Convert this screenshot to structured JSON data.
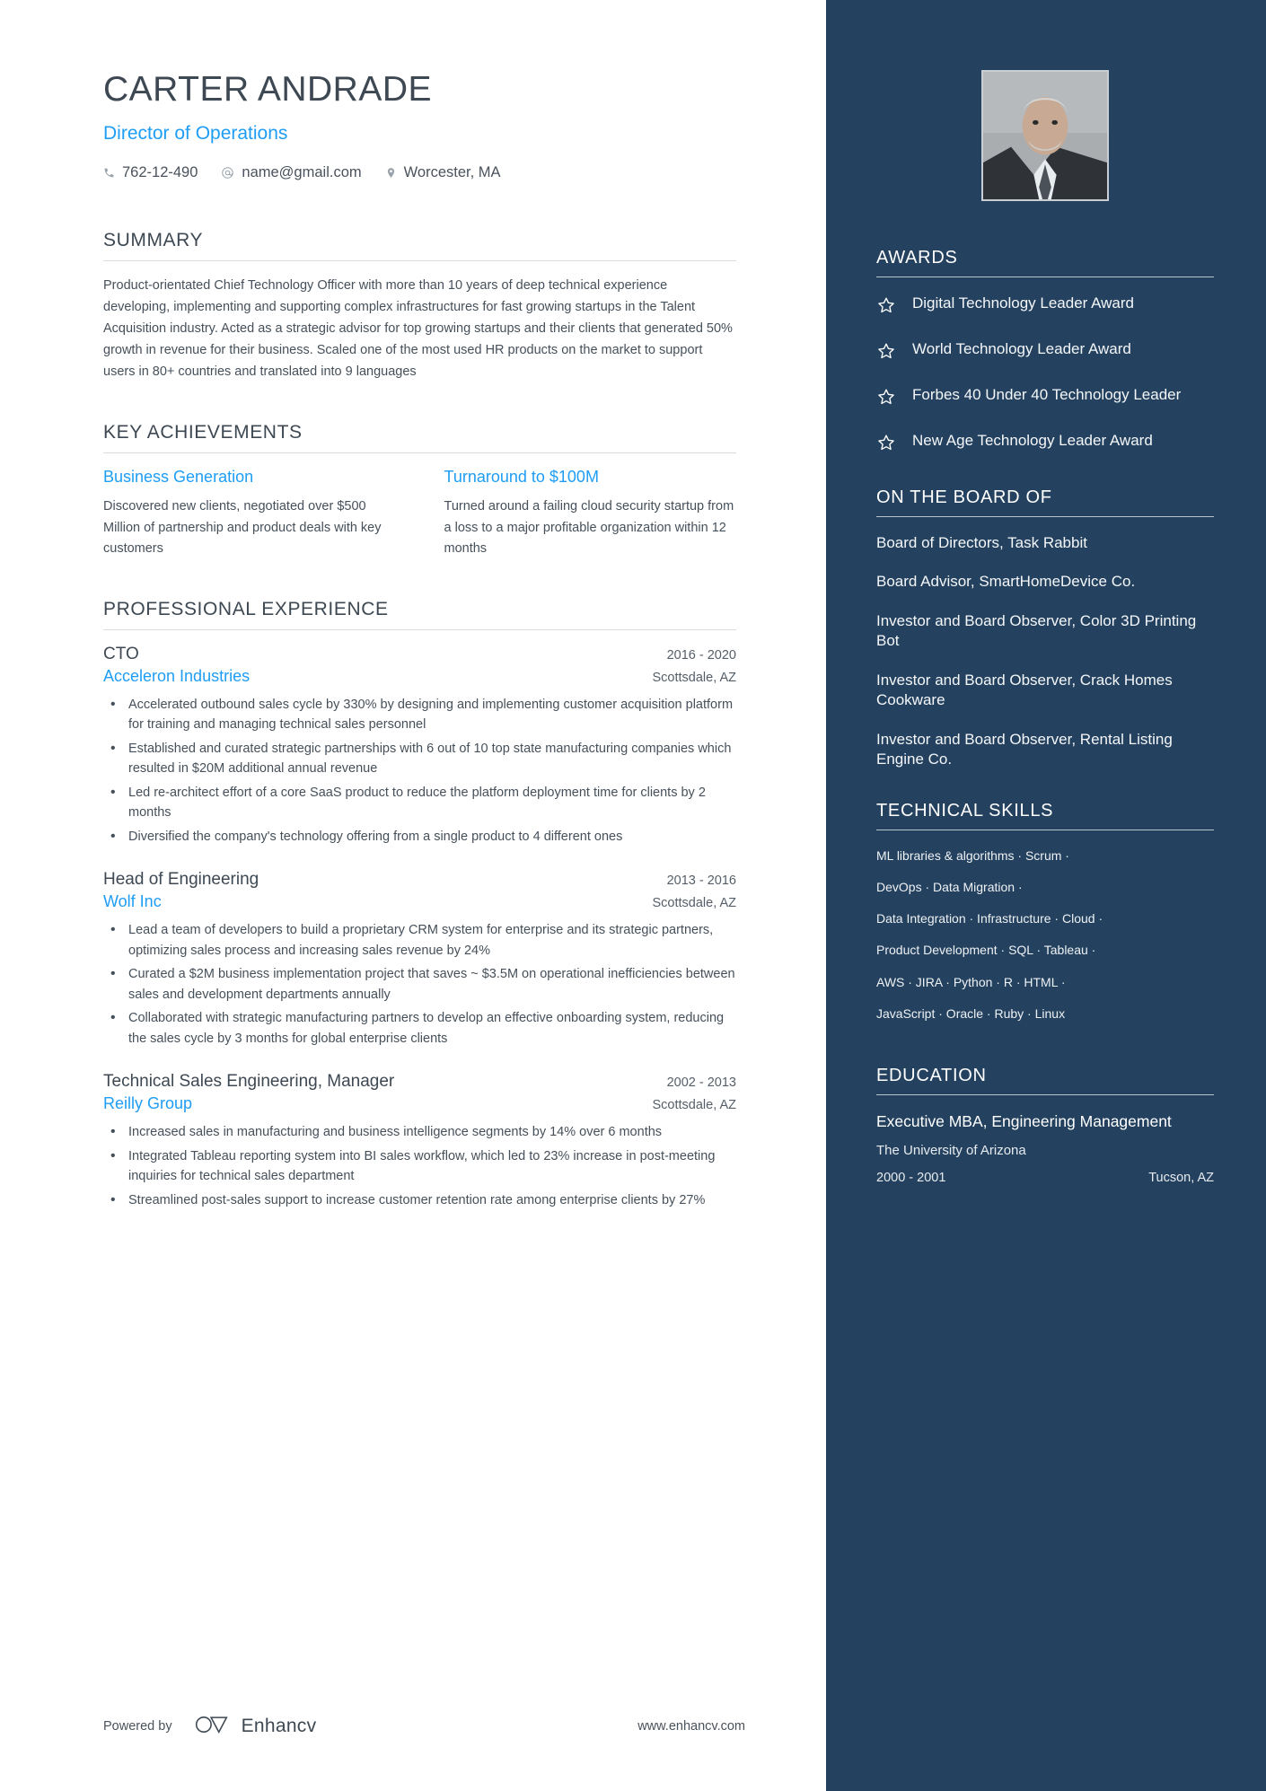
{
  "header": {
    "name": "CARTER ANDRADE",
    "job_title": "Director of Operations",
    "contacts": [
      {
        "icon": "phone-icon",
        "value": "762-12-490"
      },
      {
        "icon": "at-icon",
        "value": "name@gmail.com"
      },
      {
        "icon": "location-pin-icon",
        "value": "Worcester, MA"
      }
    ]
  },
  "summary": {
    "heading": "SUMMARY",
    "text": "Product-orientated Chief Technology Officer with more than 10 years of deep technical experience developing, implementing and supporting complex infrastructures for fast growing startups in the Talent Acquisition industry. Acted as a strategic advisor for top growing startups and their clients that generated 50% growth in revenue for their business. Scaled one of the most used HR products on the market to support users in 80+ countries and translated into 9 languages"
  },
  "key_achievements": {
    "heading": "KEY ACHIEVEMENTS",
    "items": [
      {
        "title": "Business Generation",
        "description": "Discovered new clients, negotiated over $500 Million of partnership and product deals with key customers"
      },
      {
        "title": "Turnaround to $100M",
        "description": "Turned around a failing cloud security startup from a loss to a major profitable organization within 12 months"
      }
    ]
  },
  "experience": {
    "heading": "PROFESSIONAL EXPERIENCE",
    "jobs": [
      {
        "role": "CTO",
        "date": "2016 - 2020",
        "company": "Acceleron Industries",
        "location": "Scottsdale, AZ",
        "bullets": [
          "Accelerated outbound sales cycle by 330% by designing and implementing customer acquisition platform for training and managing technical sales personnel",
          "Established and curated strategic partnerships with 6 out of 10 top state manufacturing companies which resulted in $20M additional annual revenue",
          "Led re-architect effort of a core SaaS product to reduce the platform deployment time for clients by 2 months",
          "Diversified the company's technology offering from a single product to 4 different ones"
        ]
      },
      {
        "role": "Head of Engineering",
        "date": "2013 - 2016",
        "company": "Wolf Inc",
        "location": "Scottsdale, AZ",
        "bullets": [
          "Lead a team of developers to build a proprietary CRM system for enterprise and its strategic partners, optimizing sales process and increasing sales revenue by 24%",
          "Curated a $2M business implementation project that saves ~ $3.5M on operational inefficiencies between sales and development departments annually",
          "Collaborated with strategic manufacturing partners to develop an effective onboarding system, reducing the sales cycle by 3 months for global enterprise clients"
        ]
      },
      {
        "role": "Technical Sales Engineering, Manager",
        "date": "2002 - 2013",
        "company": "Reilly Group",
        "location": "Scottsdale, AZ",
        "bullets": [
          "Increased sales in manufacturing and business intelligence segments by 14% over 6 months",
          "Integrated Tableau reporting system into BI sales workflow, which led to 23% increase in post-meeting inquiries for technical sales department",
          "Streamlined post-sales support to increase customer retention rate among enterprise clients by 27%"
        ]
      }
    ]
  },
  "awards": {
    "heading": "AWARDS",
    "items": [
      "Digital Technology Leader Award",
      "World Technology Leader Award",
      "Forbes 40 Under 40 Technology Leader",
      "New Age Technology Leader Award"
    ]
  },
  "board": {
    "heading": "ON THE BOARD OF",
    "items": [
      "Board of Directors, Task Rabbit",
      "Board Advisor, SmartHomeDevice Co.",
      "Investor and Board Observer, Color 3D Printing Bot",
      "Investor and Board Observer, Crack Homes Cookware",
      "Investor and Board Observer, Rental Listing Engine Co."
    ]
  },
  "technical_skills": {
    "heading": "TECHNICAL SKILLS",
    "lines": [
      "ML libraries & algorithms · Scrum ·",
      "DevOps · Data Migration ·",
      "Data Integration · Infrastructure · Cloud ·",
      "Product Development · SQL · Tableau ·",
      "AWS · JIRA · Python ·   R   · HTML ·",
      "JavaScript · Oracle · Ruby · Linux"
    ]
  },
  "education": {
    "heading": "EDUCATION",
    "degree": "Executive MBA, Engineering Management",
    "school": "The University of Arizona",
    "dates": "2000 - 2001",
    "location": "Tucson, AZ"
  },
  "footer": {
    "powered_by": "Powered by",
    "brand": "Enhancv",
    "website": "www.enhancv.com"
  },
  "colors": {
    "accent_blue": "#1e9df4",
    "sidebar_navy": "#24425f",
    "text_dark": "#3d4852"
  }
}
